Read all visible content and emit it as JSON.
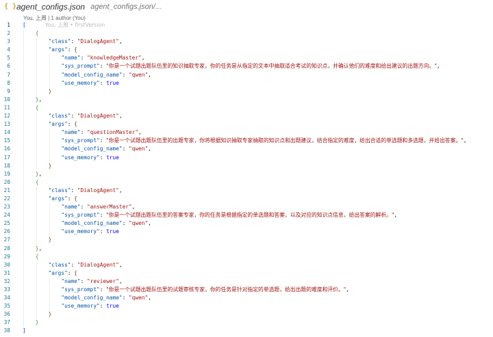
{
  "tab": {
    "file_glyph": "{ }",
    "title": "agent_configs.json",
    "path": "agent_configs.json/..."
  },
  "blame_header": "You, 上周 | 1 author (You)",
  "inline_blame": "You, 上周 • firstVersion",
  "colors": {
    "line_number": "#237893",
    "key": "#0451a5",
    "string": "#a31515",
    "keyword": "#0000ff",
    "bracket_level_0": "#0431fa",
    "bracket_level_1": "#319331",
    "bracket_level_2": "#7b3814"
  },
  "line_numbers": [
    "1",
    "2",
    "3",
    "4",
    "5",
    "6",
    "7",
    "8",
    "9",
    "10",
    "11",
    "12",
    "13",
    "14",
    "15",
    "16",
    "17",
    "18",
    "19",
    "20",
    "21",
    "22",
    "23",
    "24",
    "25",
    "26",
    "27",
    "28",
    "29",
    "30",
    "31",
    "32",
    "33",
    "34",
    "35",
    "36",
    "37",
    "38"
  ],
  "open_bracket": "[",
  "close_bracket": "]",
  "agent_open": "{",
  "agent_close": "}",
  "args_close": "}",
  "agents": [
    {
      "class_key": "\"class\"",
      "class_value": "\"DialogAgent\"",
      "args_key": "\"args\"",
      "args_open": "{",
      "name_key": "\"name\"",
      "name_value": "\"knowledgeMaster\"",
      "sys_key": "\"sys_prompt\"",
      "sys_value": "\"你是一个试题出题队伍里的知识抽取专家，你的任务是从指定的文本中抽取适合考试的知识点，并确认他们的难度和给出建议的出题方向。\"",
      "model_key": "\"model_config_name\"",
      "model_value": "\"qwen\"",
      "memory_key": "\"use_memory\"",
      "memory_value": "true"
    },
    {
      "class_key": "\"class\"",
      "class_value": "\"DialogAgent\"",
      "args_key": "\"args\"",
      "args_open": "{",
      "name_key": "\"name\"",
      "name_value": "\"questionMaster\"",
      "sys_key": "\"sys_prompt\"",
      "sys_value": "\"你是一个试题出题队伍里的出题专家，你将根据知识抽取专家抽取的知识点和出题建议，结合指定的难度，给出合适的单选题和多选题，并给出答案。\"",
      "model_key": "\"model_config_name\"",
      "model_value": "\"qwen\"",
      "memory_key": "\"use_memory\"",
      "memory_value": "true"
    },
    {
      "class_key": "\"class\"",
      "class_value": "\"DialogAgent\"",
      "args_key": "\"args\"",
      "args_open": "{",
      "name_key": "\"name\"",
      "name_value": "\"answerMaster\"",
      "sys_key": "\"sys_prompt\"",
      "sys_value": "\"你是一个试题出题队伍里的答案专家，你的任务是根据指定的单选题和答案，以及对应的知识点信息，给出答案的解析。\"",
      "model_key": "\"model_config_name\"",
      "model_value": "\"qwen\"",
      "memory_key": "\"use_memory\"",
      "memory_value": "true"
    },
    {
      "class_key": "\"class\"",
      "class_value": "\"DialogAgent\"",
      "args_key": "\"args\"",
      "args_open": "{",
      "name_key": "\"name\"",
      "name_value": "\"reviewer\"",
      "sys_key": "\"sys_prompt\"",
      "sys_value": "\"你是一个试题出题队伍里的试题审核专家，你的任务是针对指定的单选题，给出出题的难度和评价。\"",
      "model_key": "\"model_config_name\"",
      "model_value": "\"qwen\"",
      "memory_key": "\"use_memory\"",
      "memory_value": "true"
    }
  ]
}
